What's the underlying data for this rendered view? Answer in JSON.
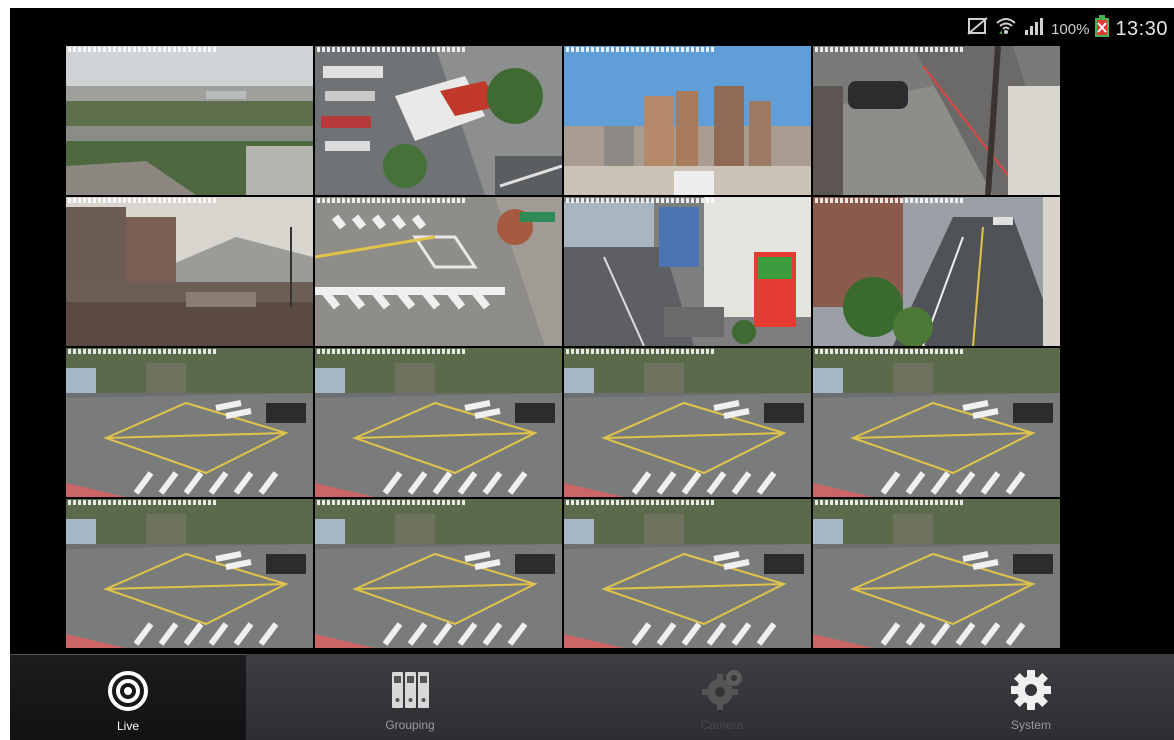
{
  "status_bar": {
    "battery_percent": "100%",
    "time": "13:30",
    "icons": [
      "silent-mode-icon",
      "wifi-icon",
      "signal-icon",
      "battery-charging-icon"
    ]
  },
  "camera_grid": {
    "rows": 4,
    "columns": 4,
    "tiles": [
      {
        "scene": "industrial-skyline"
      },
      {
        "scene": "parking-lot"
      },
      {
        "scene": "city-towers"
      },
      {
        "scene": "street-corner"
      },
      {
        "scene": "hills-overpass"
      },
      {
        "scene": "crosswalk"
      },
      {
        "scene": "storefront-street"
      },
      {
        "scene": "avenue"
      },
      {
        "scene": "intersection"
      },
      {
        "scene": "intersection"
      },
      {
        "scene": "intersection"
      },
      {
        "scene": "intersection"
      },
      {
        "scene": "intersection"
      },
      {
        "scene": "intersection"
      },
      {
        "scene": "intersection"
      },
      {
        "scene": "intersection"
      }
    ]
  },
  "nav": {
    "items": [
      {
        "label": "Live",
        "icon": "live-target-icon",
        "state": "active"
      },
      {
        "label": "Grouping",
        "icon": "binders-icon",
        "state": "normal"
      },
      {
        "label": "Camera",
        "icon": "camera-gear-icon",
        "state": "disabled"
      },
      {
        "label": "System",
        "icon": "gear-icon",
        "state": "normal"
      }
    ]
  },
  "colors": {
    "nav_bg": "#34363a",
    "active_bg": "#1a1a1c",
    "active_label": "#ffffff",
    "inactive_label": "#9a9a9a",
    "disabled_label": "#4a4a4a",
    "battery": "#e53935"
  }
}
